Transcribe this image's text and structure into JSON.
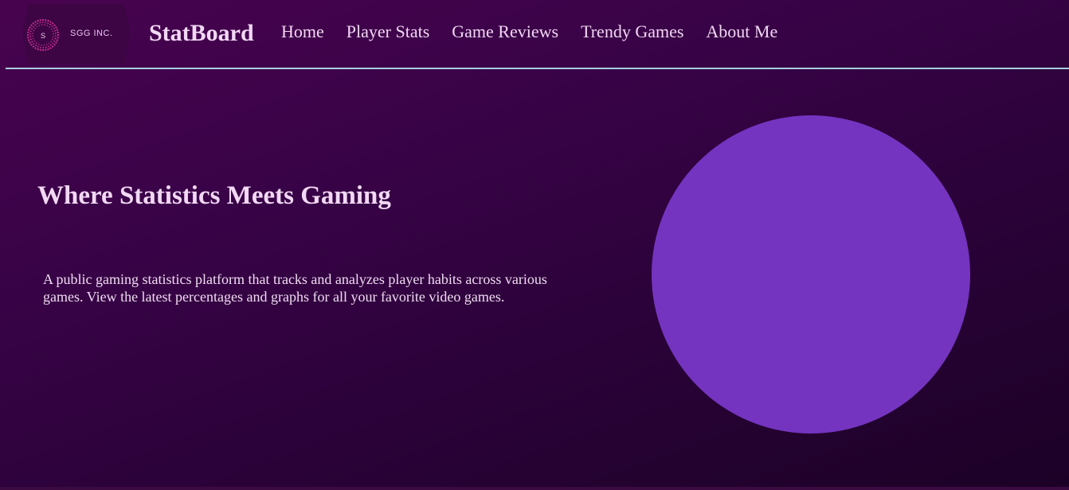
{
  "logo": {
    "mark_letter": "S",
    "company": "SGG INC."
  },
  "brand": "StatBoard",
  "nav": {
    "items": [
      {
        "label": "Home"
      },
      {
        "label": "Player Stats"
      },
      {
        "label": "Game Reviews"
      },
      {
        "label": "Trendy Games"
      },
      {
        "label": "About Me"
      }
    ]
  },
  "hero": {
    "title": "Where Statistics Meets Gaming",
    "description": "A public gaming statistics platform that tracks and analyzes player habits across various games. View the latest percentages and graphs for all your favorite video games."
  },
  "colors": {
    "accent_circle": "#7434c0",
    "divider": "#a8cfe0",
    "logo_dots": "#d0309a"
  }
}
